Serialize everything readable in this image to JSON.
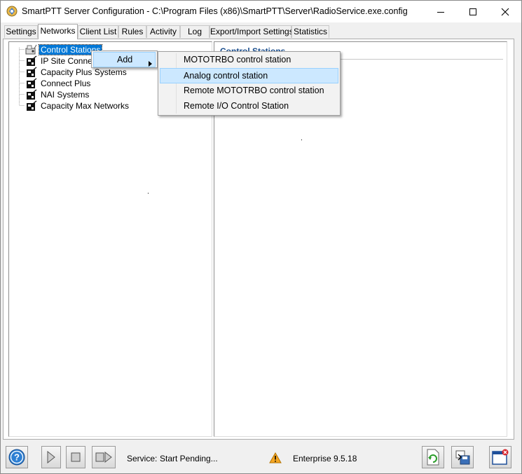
{
  "window": {
    "title": "SmartPTT Server Configuration - C:\\Program Files (x86)\\SmartPTT\\Server\\RadioService.exe.config"
  },
  "tabs": [
    {
      "label": "Settings"
    },
    {
      "label": "Networks"
    },
    {
      "label": "Client List"
    },
    {
      "label": "Rules"
    },
    {
      "label": "Activity"
    },
    {
      "label": "Log"
    },
    {
      "label": "Export/Import Settings"
    },
    {
      "label": "Statistics"
    }
  ],
  "active_tab": "Networks",
  "tree": {
    "items": [
      {
        "label": "Control Stations",
        "selected": true
      },
      {
        "label": "IP Site Connect"
      },
      {
        "label": "Capacity Plus Systems"
      },
      {
        "label": "Connect Plus"
      },
      {
        "label": "NAI Systems"
      },
      {
        "label": "Capacity Max Networks"
      }
    ]
  },
  "detail": {
    "header": "Control Stations"
  },
  "context_menu": {
    "add_label": "Add",
    "submenu": [
      {
        "label": "MOTOTRBO control station"
      },
      {
        "label": "Analog control station",
        "highlighted": true
      },
      {
        "label": "Remote MOTOTRBO control station"
      },
      {
        "label": "Remote I/O Control Station"
      }
    ]
  },
  "status": {
    "service_label": "Service:",
    "service_value": "Start Pending...",
    "edition": "Enterprise 9.5.18"
  },
  "icons": {
    "help": "help-icon",
    "start": "play-icon",
    "stop": "stop-icon",
    "restart": "restart-icon",
    "warning": "warning-icon",
    "refresh": "refresh-icon",
    "save": "save-icon",
    "close": "close-app-icon"
  },
  "colors": {
    "selection": "#0078d7",
    "menu_highlight": "#cce8ff",
    "header_text": "#1c4f8e",
    "warning": "#f5a623"
  }
}
